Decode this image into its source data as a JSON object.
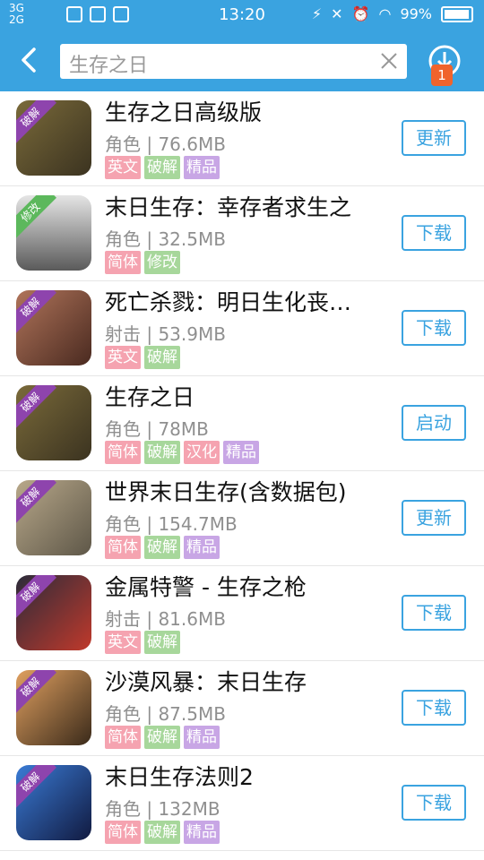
{
  "status_bar": {
    "net1": "3G",
    "net2": "2G",
    "time": "13:20",
    "battery": "99%"
  },
  "header": {
    "search_value": "生存之日",
    "download_badge": "1"
  },
  "colors": {
    "accent": "#3aa3e0",
    "tag_english": "#f5a3b0",
    "tag_simplified": "#f5a3b0",
    "tag_crack": "#a7d79b",
    "tag_mod": "#a7d79b",
    "tag_quality": "#c8a6e5",
    "tag_localized": "#f5a3b0"
  },
  "apps": [
    {
      "name": "生存之日高级版",
      "category": "角色",
      "size": "76.6MB",
      "tags": [
        "英文",
        "破解",
        "精品"
      ],
      "action": "更新",
      "ribbon": "破解"
    },
    {
      "name": "末日生存：幸存者求生之",
      "category": "角色",
      "size": "32.5MB",
      "tags": [
        "简体",
        "修改"
      ],
      "action": "下载",
      "ribbon": "修改"
    },
    {
      "name": "死亡杀戮：明日生化丧…",
      "category": "射击",
      "size": "53.9MB",
      "tags": [
        "英文",
        "破解"
      ],
      "action": "下载",
      "ribbon": "破解"
    },
    {
      "name": "生存之日",
      "category": "角色",
      "size": "78MB",
      "tags": [
        "简体",
        "破解",
        "汉化",
        "精品"
      ],
      "action": "启动",
      "ribbon": "破解"
    },
    {
      "name": "世界末日生存(含数据包)",
      "category": "角色",
      "size": "154.7MB",
      "tags": [
        "简体",
        "破解",
        "精品"
      ],
      "action": "更新",
      "ribbon": "破解"
    },
    {
      "name": "金属特警 - 生存之枪",
      "category": "射击",
      "size": "81.6MB",
      "tags": [
        "英文",
        "破解"
      ],
      "action": "下载",
      "ribbon": "破解"
    },
    {
      "name": "沙漠风暴：末日生存",
      "category": "角色",
      "size": "87.5MB",
      "tags": [
        "简体",
        "破解",
        "精品"
      ],
      "action": "下载",
      "ribbon": "破解"
    },
    {
      "name": "末日生存法则2",
      "category": "角色",
      "size": "132MB",
      "tags": [
        "简体",
        "破解",
        "精品"
      ],
      "action": "下载",
      "ribbon": "破解"
    }
  ]
}
